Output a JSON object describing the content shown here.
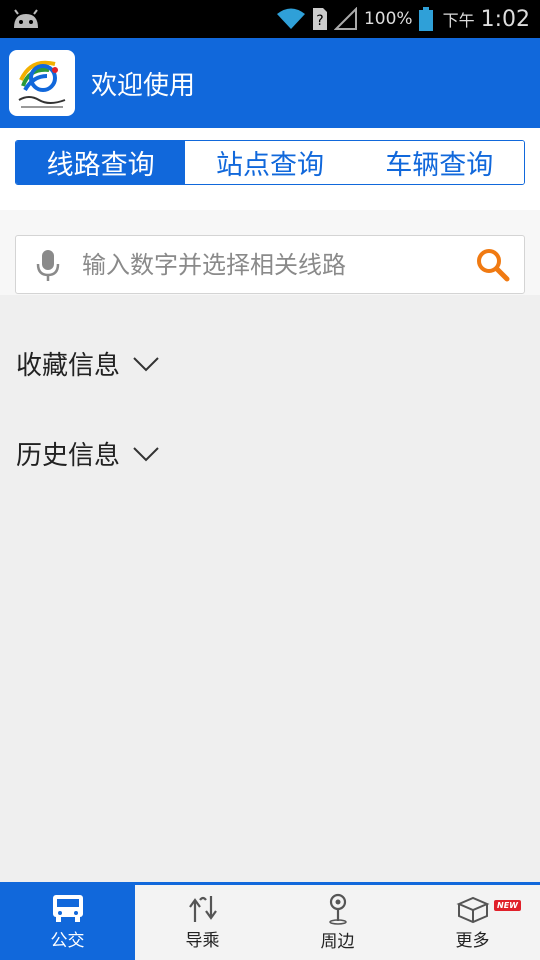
{
  "status_bar": {
    "battery": "100%",
    "ampm": "下午",
    "time": "1:02"
  },
  "app_bar": {
    "title": "欢迎使用"
  },
  "tabs": [
    {
      "label": "线路查询",
      "active": true
    },
    {
      "label": "站点查询",
      "active": false
    },
    {
      "label": "车辆查询",
      "active": false
    }
  ],
  "search": {
    "placeholder": "输入数字并选择相关线路",
    "value": ""
  },
  "sections": {
    "favorites": "收藏信息",
    "history": "历史信息"
  },
  "bottom_nav": [
    {
      "label": "公交",
      "icon": "bus-icon",
      "active": true
    },
    {
      "label": "导乘",
      "icon": "transfer-arrows-icon",
      "active": false
    },
    {
      "label": "周边",
      "icon": "location-pin-icon",
      "active": false
    },
    {
      "label": "更多",
      "icon": "box-icon",
      "active": false,
      "badge": "NEW"
    }
  ],
  "colors": {
    "primary": "#1168db",
    "search_accent": "#f07a12",
    "badge": "#e0202a"
  }
}
